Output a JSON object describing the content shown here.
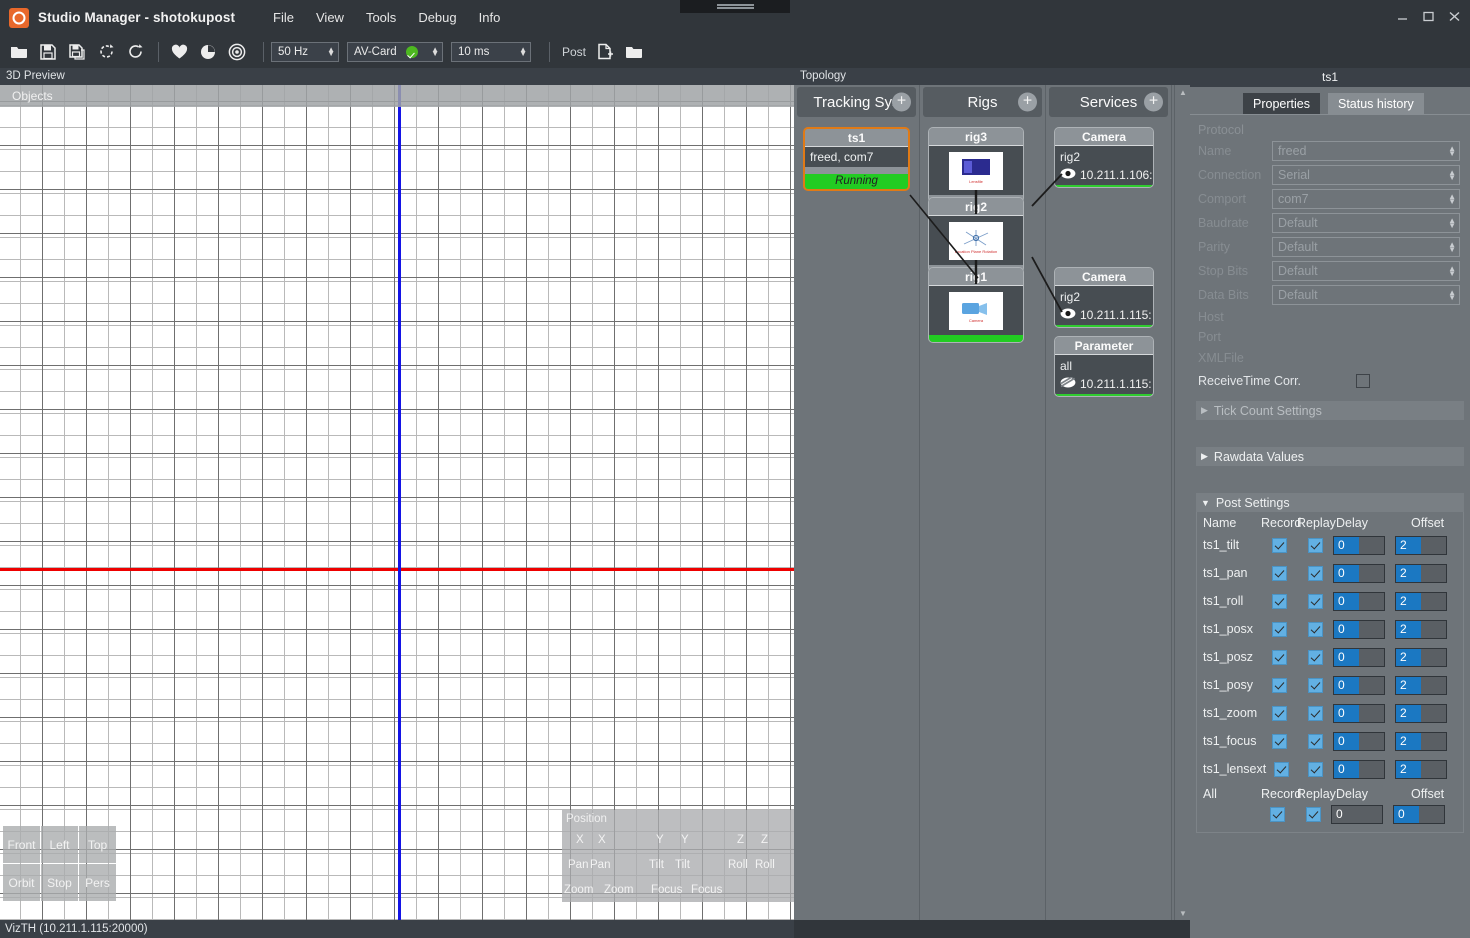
{
  "window": {
    "title": "Studio Manager - shotokupost",
    "menus": [
      "File",
      "View",
      "Tools",
      "Debug",
      "Info"
    ],
    "controls": [
      "minimize",
      "maximize",
      "close"
    ]
  },
  "toolbar": {
    "icons": [
      "open-folder-icon",
      "save-icon",
      "save-as-icon",
      "refresh-ccw-icon",
      "refresh-cw-icon",
      "heart-icon",
      "pie-clock-icon",
      "target-icon"
    ],
    "frequency": "50 Hz",
    "device": "AV-Card",
    "latency": "10 ms",
    "post_label": "Post",
    "post_icons": [
      "new-document-icon",
      "open-folder-icon"
    ]
  },
  "preview": {
    "header": "3D Preview",
    "objects_label": "Objects",
    "view_buttons": [
      "Front",
      "Left",
      "Top",
      "Orbit",
      "Stop",
      "Pers"
    ],
    "position_overlay": {
      "title": "Position",
      "rows": [
        [
          "X",
          "X",
          "Y",
          "Y",
          "Z",
          "Z"
        ],
        [
          "Pan",
          "Pan",
          "Tilt",
          "Tilt",
          "Roll",
          "Roll"
        ],
        [
          "Zoom",
          "Zoom",
          "Focus",
          "Focus",
          "",
          ""
        ]
      ]
    },
    "status": "VizTH (10.211.1.115:20000)"
  },
  "topology": {
    "header": "Topology",
    "columns": [
      {
        "title": "Tracking Sys",
        "add_icon": "plus-circle-icon",
        "nodes": [
          {
            "name": "ts1",
            "detail": "freed,  com7",
            "status": "Running",
            "selected": true,
            "state_color": "#22cc22"
          }
        ]
      },
      {
        "title": "Rigs",
        "add_icon": "plus-circle-icon",
        "nodes": [
          {
            "name": "rig3",
            "thumb_caption": "Lensfile",
            "bar_color": "#8d9398"
          },
          {
            "name": "rig2",
            "thumb_caption": "Location Plane Rotation",
            "bar_color": "#8d9398"
          },
          {
            "name": "rig1",
            "thumb_caption": "Camera",
            "bar_color": "#22cc22"
          }
        ]
      },
      {
        "title": "Services",
        "add_icon": "plus-circle-icon",
        "nodes": [
          {
            "name": "Camera",
            "subject": "rig2",
            "icon": "eye-icon",
            "address": "10.211.1.106:"
          },
          {
            "name": "Camera",
            "subject": "rig2",
            "icon": "eye-icon",
            "address": "10.211.1.115:"
          },
          {
            "name": "Parameter",
            "subject": "all",
            "icon": "disabled-eye-icon",
            "address": "10.211.1.115:"
          }
        ]
      }
    ]
  },
  "properties": {
    "title": "ts1",
    "tabs": [
      {
        "label": "Properties",
        "active": true
      },
      {
        "label": "Status history",
        "active": false
      }
    ],
    "section": "Protocol",
    "fields": [
      {
        "label": "Name",
        "value": "freed",
        "has_spinner": true,
        "enabled": false
      },
      {
        "label": "Connection",
        "value": "Serial",
        "has_spinner": true,
        "enabled": false
      },
      {
        "label": "Comport",
        "value": "com7",
        "has_spinner": true,
        "enabled": false
      },
      {
        "label": "Baudrate",
        "value": "Default",
        "has_spinner": true,
        "enabled": false
      },
      {
        "label": "Parity",
        "value": "Default",
        "has_spinner": true,
        "enabled": false
      },
      {
        "label": "Stop Bits",
        "value": "Default",
        "has_spinner": true,
        "enabled": false
      },
      {
        "label": "Data Bits",
        "value": "Default",
        "has_spinner": true,
        "enabled": false
      },
      {
        "label": "Host",
        "value": "",
        "has_spinner": false,
        "enabled": false
      },
      {
        "label": "Port",
        "value": "",
        "has_spinner": false,
        "enabled": false
      },
      {
        "label": "XMLFile",
        "value": "",
        "has_spinner": false,
        "enabled": false
      }
    ],
    "receive_time_label": "ReceiveTime Corr.",
    "receive_time_checked": false,
    "collapsers": [
      {
        "label": "Tick Count Settings",
        "expanded": false,
        "dim": true
      },
      {
        "label": "Rawdata Values",
        "expanded": false,
        "dim": false
      }
    ],
    "post_settings": {
      "title": "Post Settings",
      "expanded": true,
      "headers": [
        "Name",
        "Record",
        "Replay",
        "Delay",
        "Offset"
      ],
      "rows": [
        {
          "name": "ts1_tilt",
          "record": true,
          "replay": true,
          "delay": "0",
          "offset": "2"
        },
        {
          "name": "ts1_pan",
          "record": true,
          "replay": true,
          "delay": "0",
          "offset": "2"
        },
        {
          "name": "ts1_roll",
          "record": true,
          "replay": true,
          "delay": "0",
          "offset": "2"
        },
        {
          "name": "ts1_posx",
          "record": true,
          "replay": true,
          "delay": "0",
          "offset": "2"
        },
        {
          "name": "ts1_posz",
          "record": true,
          "replay": true,
          "delay": "0",
          "offset": "2"
        },
        {
          "name": "ts1_posy",
          "record": true,
          "replay": true,
          "delay": "0",
          "offset": "2"
        },
        {
          "name": "ts1_zoom",
          "record": true,
          "replay": true,
          "delay": "0",
          "offset": "2"
        },
        {
          "name": "ts1_focus",
          "record": true,
          "replay": true,
          "delay": "0",
          "offset": "2"
        },
        {
          "name": "ts1_lensext",
          "record": true,
          "replay": true,
          "delay": "0",
          "offset": "2"
        }
      ],
      "all_row": {
        "name": "All",
        "record": true,
        "replay": true,
        "delay": "0",
        "offset": "0"
      }
    }
  },
  "colors": {
    "chrome": "#31363b",
    "panel": "#6e7479",
    "accent_orange": "#e8682b",
    "status_green": "#22cc22",
    "select_blue": "#1b78c2",
    "checkbox_blue": "#62b0e3"
  }
}
